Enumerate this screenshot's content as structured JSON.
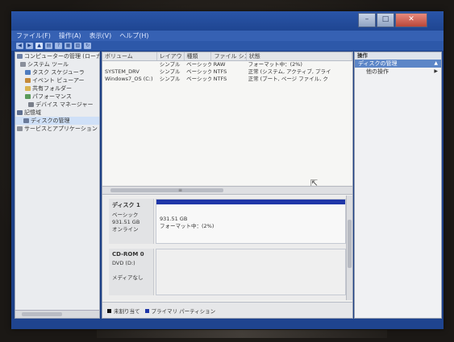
{
  "menu": [
    "ファイル(F)",
    "操作(A)",
    "表示(V)",
    "ヘルプ(H)"
  ],
  "tree": [
    {
      "label": "コンピューターの管理 (ローカ",
      "icon": "computer-icon",
      "indent": 0
    },
    {
      "label": "システム ツール",
      "icon": "tools-icon",
      "indent": 1
    },
    {
      "label": "タスク スケジューラ",
      "icon": "clock-icon",
      "indent": 2
    },
    {
      "label": "イベント ビューアー",
      "icon": "event-icon",
      "indent": 2
    },
    {
      "label": "共有フォルダー",
      "icon": "folder-icon",
      "indent": 2
    },
    {
      "label": "パフォーマンス",
      "icon": "chart-icon",
      "indent": 2
    },
    {
      "label": "デバイス マネージャー",
      "icon": "device-icon",
      "indent": 2
    },
    {
      "label": "記憶域",
      "icon": "storage-icon",
      "indent": 1
    },
    {
      "label": "ディスクの管理",
      "icon": "disk-icon",
      "indent": 2,
      "selected": true
    },
    {
      "label": "サービスとアプリケーション",
      "icon": "services-icon",
      "indent": 1
    }
  ],
  "volumes": {
    "headers": [
      "ボリューム",
      "レイアウト",
      "種類",
      "ファイル システム",
      "状態"
    ],
    "rows": [
      [
        "",
        "シンプル",
        "ベーシック",
        "RAW",
        "フォーマット中：(2%)"
      ],
      [
        "SYSTEM_DRV",
        "シンプル",
        "ベーシック",
        "NTFS",
        "正常 (システム, アクティブ, プライ"
      ],
      [
        "Windows7_OS (C:)",
        "シンプル",
        "ベーシック",
        "NTFS",
        "正常 (ブート, ページ ファイル, ク"
      ]
    ]
  },
  "disks": [
    {
      "title": "ディスク 1",
      "lines": [
        "ベーシック",
        "931.51 GB",
        "オンライン"
      ],
      "partition_lines": [
        "931.51 GB",
        "フォーマット中：(2%)"
      ]
    },
    {
      "title": "CD-ROM 0",
      "lines": [
        "DVD (D:)",
        "",
        "メディアなし"
      ],
      "partition_lines": []
    }
  ],
  "legend": [
    {
      "label": "未割り当て",
      "color": "#111111"
    },
    {
      "label": "プライマリ パーティション",
      "color": "#1f36a8"
    }
  ],
  "actions": {
    "header": "操作",
    "section": "ディスクの管理",
    "items": [
      "他の操作"
    ]
  },
  "colors": {
    "titlebar": "#1c3f86",
    "partition_bar": "#1f36a8"
  }
}
